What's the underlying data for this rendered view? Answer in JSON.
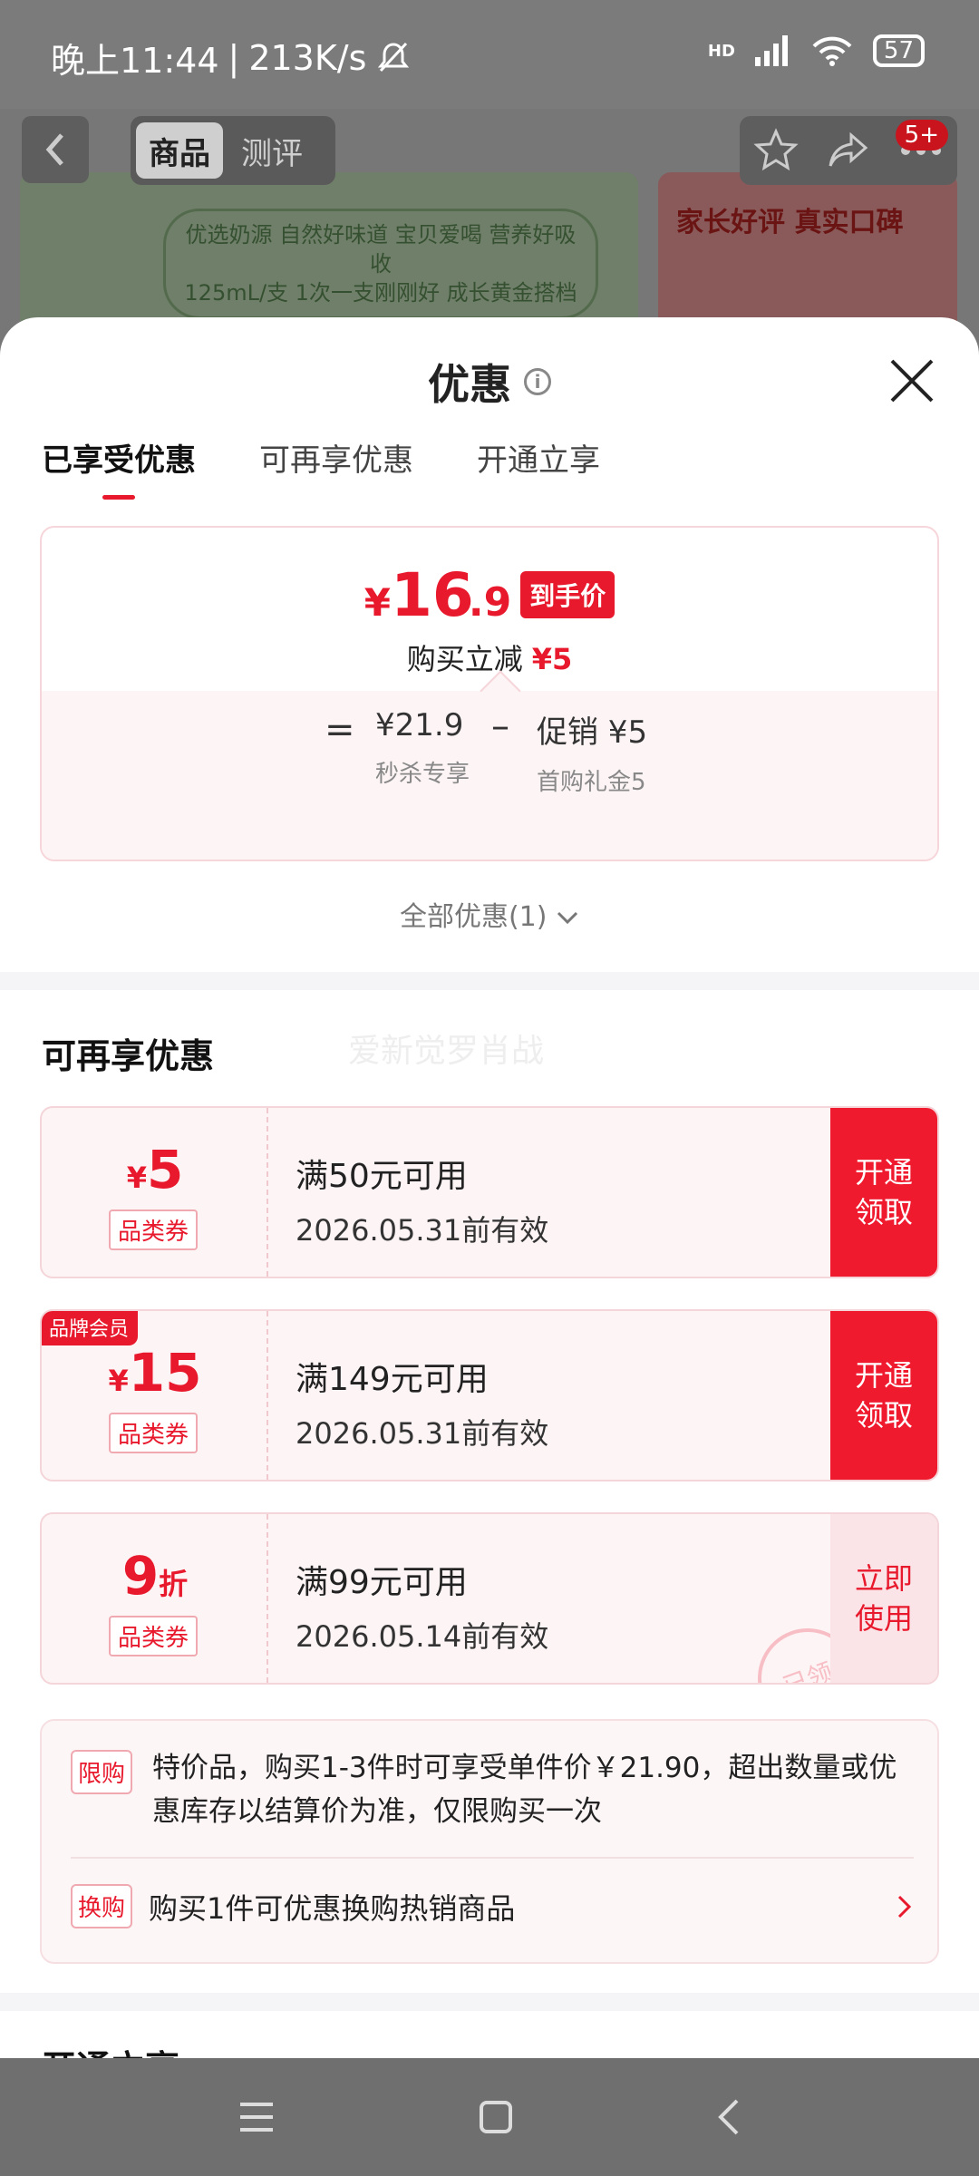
{
  "status": {
    "time": "晚上11:44",
    "sep": "|",
    "speed": "213K/s",
    "battery": "57",
    "network": "HD"
  },
  "background": {
    "tabs": [
      "商品",
      "测评"
    ],
    "badge": "5+",
    "banner_text_line1": "优选奶源 自然好味道 宝贝爱喝 营养好吸收",
    "banner_text_line2": "125mL/支 1次一支刚刚好 成长黄金搭档",
    "banner_right_title": "家长好评 真实口碑"
  },
  "sheet": {
    "title": "优惠",
    "tabs": [
      "已享受优惠",
      "可再享优惠",
      "开通立享"
    ],
    "price": {
      "yen": "¥",
      "int": "16",
      "dec": ".9",
      "tag": "到手价"
    },
    "reduce": {
      "label": "购买立减",
      "amount": "¥5"
    },
    "formula": {
      "eq": "=",
      "base_value": "¥21.9",
      "base_label": "秒杀专享",
      "minus": "–",
      "promo_value": "促销 ¥5",
      "promo_label": "首购礼金5"
    },
    "all_offers": "全部优惠(1)",
    "section_title": "可再享优惠",
    "watermark": "爱新觉罗肖战",
    "coupons": [
      {
        "sym": "¥",
        "num": "5",
        "unit": "",
        "type": "品类券",
        "cond": "满50元可用",
        "date": "2026.05.31前有效",
        "btn": "开通\n领取",
        "corner": ""
      },
      {
        "sym": "¥",
        "num": "15",
        "unit": "",
        "type": "品类券",
        "cond": "满149元可用",
        "date": "2026.05.31前有效",
        "btn": "开通\n领取",
        "corner": "品牌会员"
      },
      {
        "sym": "",
        "num": "9",
        "unit": "折",
        "type": "品类券",
        "cond": "满99元可用",
        "date": "2026.05.14前有效",
        "btn": "立即\n使用",
        "corner": "",
        "stamp": "已领"
      }
    ],
    "limit": {
      "badge1": "限购",
      "text1": "特价品，购买1-3件时可享受单件价￥21.90，超出数量或优惠库存以结算价为准，仅限购买一次",
      "badge2": "换购",
      "text2": "购买1件可优惠换购热销商品"
    },
    "next_section_title": "开通立享"
  },
  "colors": {
    "accent": "#e8192c",
    "coupon_bg": "#fdf4f5"
  }
}
